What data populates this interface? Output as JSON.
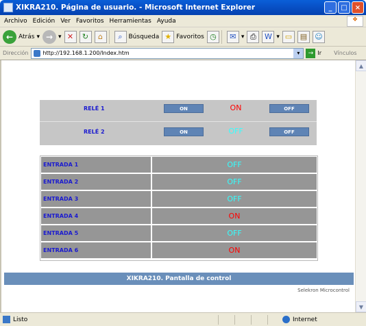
{
  "window": {
    "title": "XIKRA210. Página de usuario. - Microsoft Internet Explorer",
    "minimize": "_",
    "maximize": "□",
    "close": "×"
  },
  "menu": [
    "Archivo",
    "Edición",
    "Ver",
    "Favoritos",
    "Herramientas",
    "Ayuda"
  ],
  "toolbar": {
    "back": "Atrás",
    "search": "Búsqueda",
    "favorites": "Favoritos"
  },
  "address": {
    "label": "Dirección",
    "url": "http://192.168.1.200/Index.htm",
    "go": "Ir",
    "links": "Vínculos"
  },
  "relays": [
    {
      "label": "RELÉ 1",
      "on_btn": "ON",
      "state": "ON",
      "state_color": "#ff0000",
      "off_btn": "OFF"
    },
    {
      "label": "RELÉ 2",
      "on_btn": "ON",
      "state": "OFF",
      "state_color": "#33ffff",
      "off_btn": "OFF"
    }
  ],
  "inputs": [
    {
      "label": "ENTRADA 1",
      "state": "OFF",
      "state_color": "#33ffff"
    },
    {
      "label": "ENTRADA 2",
      "state": "OFF",
      "state_color": "#33ffff"
    },
    {
      "label": "ENTRADA 3",
      "state": "OFF",
      "state_color": "#33ffff"
    },
    {
      "label": "ENTRADA 4",
      "state": "ON",
      "state_color": "#ff0000"
    },
    {
      "label": "ENTRADA 5",
      "state": "OFF",
      "state_color": "#33ffff"
    },
    {
      "label": "ENTRADA 6",
      "state": "ON",
      "state_color": "#ff0000"
    }
  ],
  "footer": {
    "title": "XIKRA210. Pantalla de control",
    "credit": "Selekron Microcontrol"
  },
  "status": {
    "text": "Listo",
    "zone": "Internet"
  }
}
